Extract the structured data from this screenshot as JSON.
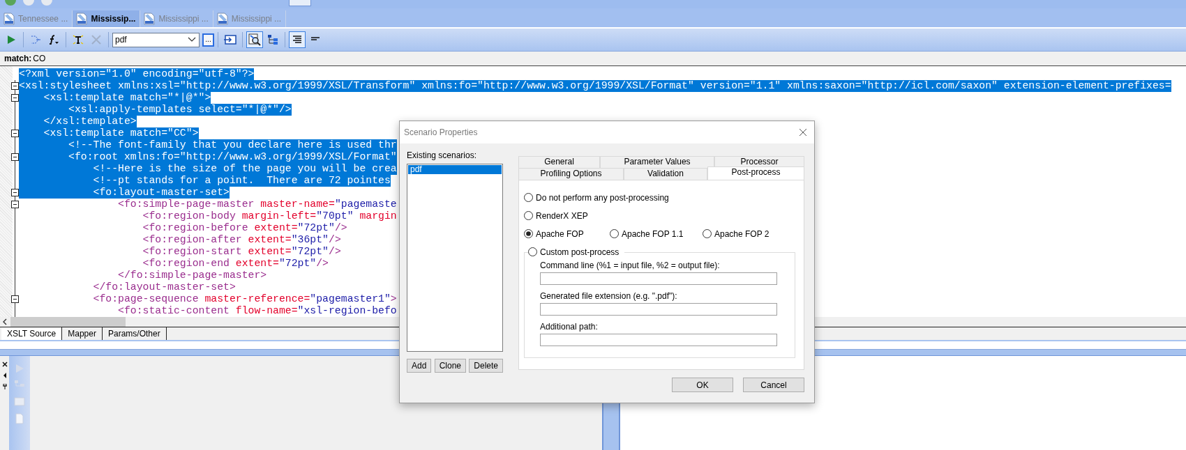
{
  "document_tabs": [
    {
      "label": "Tennessee ...",
      "selected": false
    },
    {
      "label": "Mississip...",
      "selected": true
    },
    {
      "label": "Mississippi ...",
      "selected": false
    },
    {
      "label": "Mississippi ...",
      "selected": false
    }
  ],
  "toolbar": {
    "buttons_left": [
      {
        "kind": "run",
        "disabled": false
      },
      {
        "kind": "mapping",
        "disabled": false
      },
      {
        "kind": "function",
        "disabled": false
      },
      {
        "kind": "text-tool",
        "disabled": false
      },
      {
        "kind": "tools",
        "disabled": true
      }
    ],
    "scenario": {
      "value": "pdf"
    },
    "browse_button": "...",
    "buttons_right": [
      {
        "kind": "import",
        "pressed": false
      },
      {
        "kind": "inspect",
        "pressed": true
      },
      {
        "kind": "tree",
        "pressed": false
      },
      {
        "kind": "align-right",
        "pressed": true
      },
      {
        "kind": "align-left",
        "pressed": false
      }
    ]
  },
  "match_bar": {
    "label": "match:",
    "value": "CO"
  },
  "code_lines": [
    {
      "selected": true,
      "foldable": false,
      "parts": [
        {
          "kind": "plain",
          "text": "<?xml version=\"1.0\" encoding=\"utf-8\"?>"
        }
      ]
    },
    {
      "selected": true,
      "foldable": true,
      "parts": [
        {
          "kind": "plain",
          "text": "<xsl:stylesheet xmlns:xsl=\"http://www.w3.org/1999/XSL/Transform\" xmlns:fo=\"http://www.w3.org/1999/XSL/Format\" version=\"1.1\" xmlns:saxon=\"http://icl.com/saxon\" extension-element-prefixes="
        }
      ]
    },
    {
      "selected": true,
      "foldable": true,
      "parts": [
        {
          "kind": "plain",
          "text": "    <xsl:template match=\"*|@*\">"
        }
      ]
    },
    {
      "selected": true,
      "foldable": false,
      "parts": [
        {
          "kind": "plain",
          "text": "        <xsl:apply-templates select=\"*|@*\"/>"
        }
      ]
    },
    {
      "selected": true,
      "foldable": false,
      "parts": [
        {
          "kind": "plain",
          "text": "    </xsl:template>"
        }
      ]
    },
    {
      "selected": true,
      "foldable": true,
      "parts": [
        {
          "kind": "plain",
          "text": "    <xsl:template match=\"CC\">"
        }
      ]
    },
    {
      "selected": true,
      "foldable": false,
      "parts": [
        {
          "kind": "plain",
          "text": "        <!--The font-family that you declare here is used thr"
        }
      ]
    },
    {
      "selected": true,
      "foldable": true,
      "parts": [
        {
          "kind": "plain",
          "text": "        <fo:root xmlns:fo=\"http://www.w3.org/1999/XSL/Format\""
        }
      ]
    },
    {
      "selected": true,
      "foldable": false,
      "parts": [
        {
          "kind": "plain",
          "text": "            <!--Here is the size of the page you will be crea"
        }
      ]
    },
    {
      "selected": true,
      "foldable": false,
      "parts": [
        {
          "kind": "plain",
          "text": "            <!--pt stands for a point.  There are 72 pointes"
        }
      ]
    },
    {
      "selected": true,
      "foldable": true,
      "parts": [
        {
          "kind": "plain",
          "text": "            <fo:layout-master-set>"
        }
      ]
    },
    {
      "selected": false,
      "foldable": true,
      "parts": [
        {
          "kind": "tag",
          "text": "                <fo:simple-page-master"
        },
        {
          "kind": "attr",
          "text": " master-name="
        },
        {
          "kind": "value",
          "text": "\"pagemaste"
        }
      ]
    },
    {
      "selected": false,
      "foldable": false,
      "parts": [
        {
          "kind": "tag",
          "text": "                    <fo:region-body"
        },
        {
          "kind": "attr",
          "text": " margin-left="
        },
        {
          "kind": "value",
          "text": "\"70pt\""
        },
        {
          "kind": "attr",
          "text": " margin"
        }
      ]
    },
    {
      "selected": false,
      "foldable": false,
      "parts": [
        {
          "kind": "tag",
          "text": "                    <fo:region-before"
        },
        {
          "kind": "attr",
          "text": " extent="
        },
        {
          "kind": "value",
          "text": "\"72pt\""
        },
        {
          "kind": "tag",
          "text": "/>"
        }
      ]
    },
    {
      "selected": false,
      "foldable": false,
      "parts": [
        {
          "kind": "tag",
          "text": "                    <fo:region-after"
        },
        {
          "kind": "attr",
          "text": " extent="
        },
        {
          "kind": "value",
          "text": "\"36pt\""
        },
        {
          "kind": "tag",
          "text": "/>"
        }
      ]
    },
    {
      "selected": false,
      "foldable": false,
      "parts": [
        {
          "kind": "tag",
          "text": "                    <fo:region-start"
        },
        {
          "kind": "attr",
          "text": " extent="
        },
        {
          "kind": "value",
          "text": "\"72pt\""
        },
        {
          "kind": "tag",
          "text": "/>"
        }
      ]
    },
    {
      "selected": false,
      "foldable": false,
      "parts": [
        {
          "kind": "tag",
          "text": "                    <fo:region-end"
        },
        {
          "kind": "attr",
          "text": " extent="
        },
        {
          "kind": "value",
          "text": "\"72pt\""
        },
        {
          "kind": "tag",
          "text": "/>"
        }
      ]
    },
    {
      "selected": false,
      "foldable": false,
      "parts": [
        {
          "kind": "tag",
          "text": "                </fo:simple-page-master>"
        }
      ]
    },
    {
      "selected": false,
      "foldable": false,
      "parts": [
        {
          "kind": "tag",
          "text": "            </fo:layout-master-set>"
        }
      ]
    },
    {
      "selected": false,
      "foldable": true,
      "parts": [
        {
          "kind": "tag",
          "text": "            <fo:page-sequence"
        },
        {
          "kind": "attr",
          "text": " master-reference="
        },
        {
          "kind": "value",
          "text": "\"pagemaster1\""
        },
        {
          "kind": "tag",
          "text": ">"
        }
      ]
    },
    {
      "selected": false,
      "foldable": false,
      "parts": [
        {
          "kind": "tag",
          "text": "                <fo:static-content"
        },
        {
          "kind": "attr",
          "text": " flow-name="
        },
        {
          "kind": "value",
          "text": "\"xsl-region-befo"
        }
      ]
    }
  ],
  "editor_tabs": [
    {
      "label": "XSLT Source",
      "selected": true
    },
    {
      "label": "Mapper",
      "selected": false
    },
    {
      "label": "Params/Other",
      "selected": false
    }
  ],
  "dialog": {
    "title": "Scenario Properties",
    "scenarios_label": "Existing scenarios:",
    "scenarios": [
      {
        "label": "pdf",
        "selected": true
      }
    ],
    "list_buttons": [
      "Add",
      "Clone",
      "Delete"
    ],
    "tab_rows": [
      [
        {
          "label": "General",
          "selected": false
        },
        {
          "label": "Parameter Values",
          "selected": false
        },
        {
          "label": "Processor",
          "selected": false
        }
      ],
      [
        {
          "label": "Profiling Options",
          "selected": false
        },
        {
          "label": "Validation",
          "selected": false
        },
        {
          "label": "Post-process",
          "selected": true
        }
      ]
    ],
    "option_rows": [
      [
        {
          "label": "Do not perform any post-processing",
          "selected": false
        }
      ],
      [
        {
          "label": "RenderX XEP",
          "selected": false
        }
      ],
      [
        {
          "label": "Apache FOP",
          "selected": true
        },
        {
          "label": "Apache FOP 1.1",
          "selected": false
        },
        {
          "label": "Apache FOP 2",
          "selected": false
        }
      ]
    ],
    "custom": {
      "label": "Custom post-process",
      "selected": false,
      "fields": [
        {
          "label": "Command line (%1 = input file, %2 = output file):"
        },
        {
          "label": "Generated file extension (e.g. \".pdf\"):"
        },
        {
          "label": "Additional path:"
        }
      ]
    },
    "buttons": [
      "OK",
      "Cancel"
    ]
  }
}
